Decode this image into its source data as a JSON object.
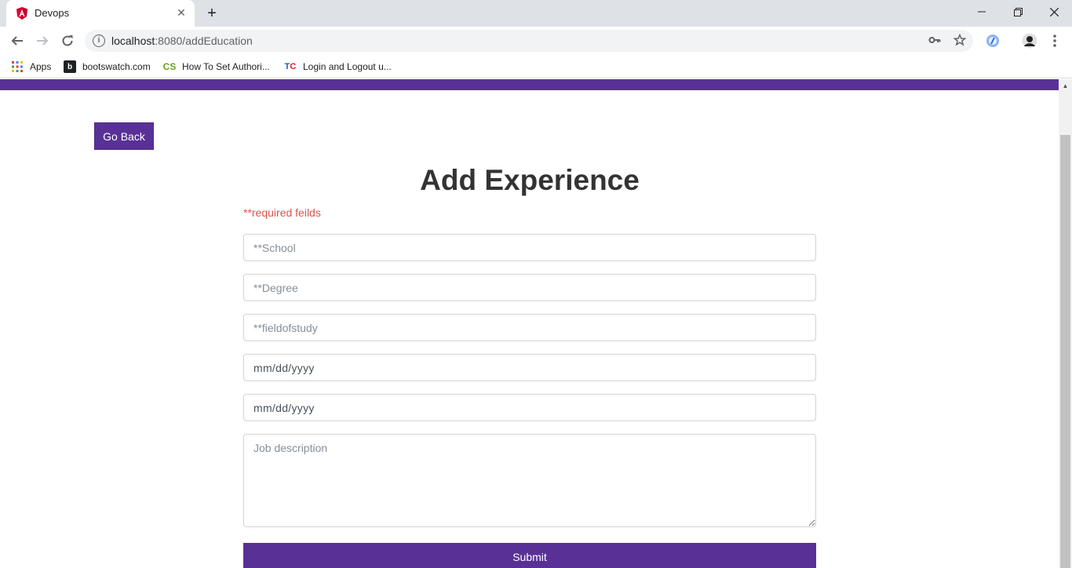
{
  "browser": {
    "tab_title": "Devops",
    "url_host": "localhost",
    "url_path": ":8080/addEducation",
    "bookmarks": [
      {
        "label": "Apps",
        "icon": "apps-grid-icon"
      },
      {
        "label": "bootswatch.com",
        "icon": "bootswatch-icon"
      },
      {
        "label": "How To Set Authori...",
        "icon": "cs-icon"
      },
      {
        "label": "Login and Logout u...",
        "icon": "tc-icon"
      }
    ]
  },
  "page": {
    "go_back_label": "Go Back",
    "heading": "Add Experience",
    "required_note": "**required feilds",
    "fields": {
      "school_placeholder": "**School",
      "degree_placeholder": "**Degree",
      "fieldofstudy_placeholder": "**fieldofstudy",
      "from_date_text": "mm/dd/yyyy",
      "to_date_text": "mm/dd/yyyy",
      "description_placeholder": "Job description"
    },
    "submit_label": "Submit"
  },
  "colors": {
    "primary": "#593196",
    "required": "#d9534f"
  }
}
